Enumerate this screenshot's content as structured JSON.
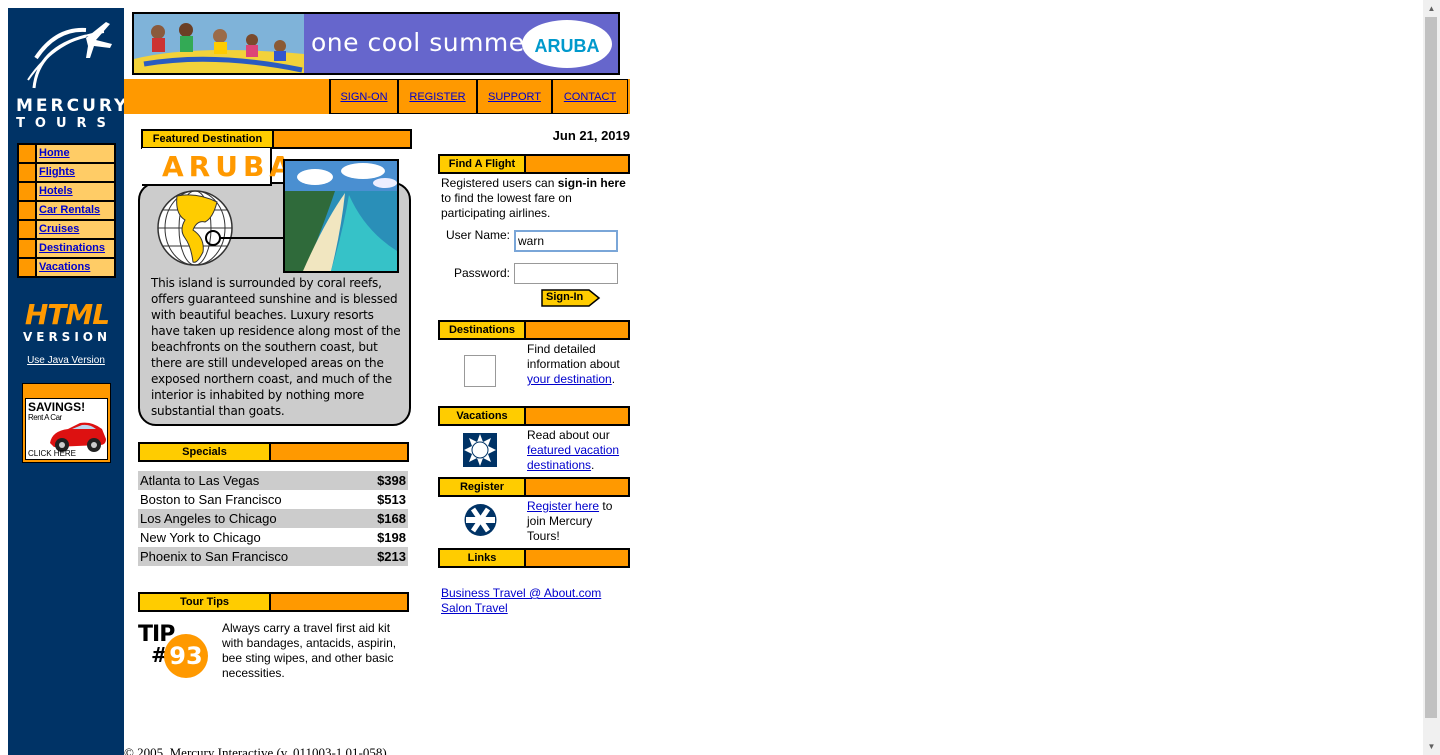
{
  "brand": {
    "logo_line1": "MERCURY",
    "logo_line2": "TOURS"
  },
  "sidebar": {
    "items": [
      {
        "label": "Home"
      },
      {
        "label": "Flights"
      },
      {
        "label": "Hotels"
      },
      {
        "label": "Car Rentals"
      },
      {
        "label": "Cruises"
      },
      {
        "label": "Destinations"
      },
      {
        "label": "Vacations"
      }
    ],
    "html_word": "HTML",
    "version_word": "VERSION",
    "java_link": "Use Java Version",
    "ad": {
      "title": "SAVINGS!",
      "sub": "Rent A Car",
      "click": "CLICK HERE"
    }
  },
  "banner": {
    "title": "one cool summer",
    "badge": "ARUBA"
  },
  "topnav": {
    "signon": "SIGN-ON",
    "register": "REGISTER",
    "support": "SUPPORT",
    "contact": "CONTACT"
  },
  "featured": {
    "header": "Featured Destination",
    "title": "ARUBA",
    "text": "This island is surrounded by coral reefs, offers guaranteed sunshine and is blessed with beautiful beaches. Luxury resorts have taken up residence along most of the beachfronts on the southern coast, but there are still undeveloped areas on the exposed northern coast, and much of the interior is inhabited by nothing more substantial than goats."
  },
  "specials": {
    "header": "Specials",
    "rows": [
      {
        "route": "Atlanta to Las Vegas",
        "price": "$398"
      },
      {
        "route": "Boston to San Francisco",
        "price": "$513"
      },
      {
        "route": "Los Angeles to Chicago",
        "price": "$168"
      },
      {
        "route": "New York to Chicago",
        "price": "$198"
      },
      {
        "route": "Phoenix to San Francisco",
        "price": "$213"
      }
    ]
  },
  "tips": {
    "header": "Tour Tips",
    "tip_word": "TIP",
    "tip_hash": "#",
    "tip_number": "93",
    "text": "Always carry a travel first aid kit with bandages, antacids, aspirin, bee sting wipes, and other basic necessities."
  },
  "date": "Jun 21, 2019",
  "find_flight": {
    "header": "Find A Flight",
    "intro_a": "Registered users can ",
    "intro_bold": "sign-in here",
    "intro_b": " to find the lowest fare on participating airlines.",
    "user_label": "User Name:",
    "user_value": "warn",
    "password_label": "Password:",
    "signin_label": "Sign-In"
  },
  "destinations": {
    "header": "Destinations",
    "text_a": "Find detailed information about ",
    "link": "your destination",
    "text_b": "."
  },
  "vacations": {
    "header": "Vacations",
    "text_a": "Read about our ",
    "link": "featured vacation destinations",
    "text_b": "."
  },
  "register": {
    "header": "Register",
    "link": "Register here",
    "text_b": " to join Mercury Tours!"
  },
  "links": {
    "header": "Links",
    "items": [
      "Business Travel @ About.com",
      "Salon Travel"
    ]
  },
  "footer": "© 2005, Mercury Interactive (v. 011003-1.01-058)"
}
